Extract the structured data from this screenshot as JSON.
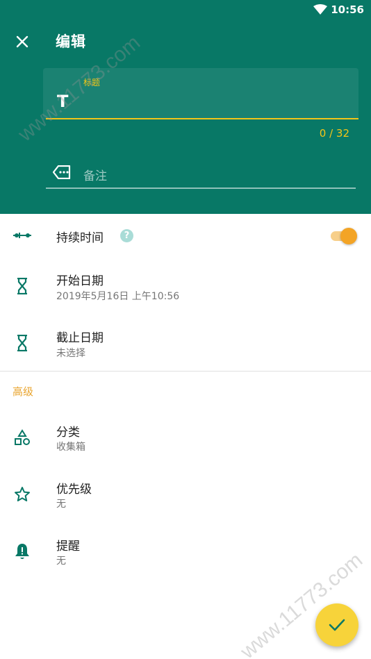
{
  "status_bar": {
    "time": "10:56"
  },
  "header": {
    "title": "编辑",
    "title_field": {
      "label": "标题",
      "value": "T",
      "counter": "0 / 32"
    },
    "note_field": {
      "placeholder": "备注"
    }
  },
  "rows": {
    "duration": {
      "title": "持续时间",
      "help": "?",
      "toggle_on": true
    },
    "start_date": {
      "title": "开始日期",
      "subtitle": "2019年5月16日 上午10:56"
    },
    "due_date": {
      "title": "截止日期",
      "subtitle": "未选择"
    }
  },
  "advanced": {
    "label": "高级",
    "category": {
      "title": "分类",
      "subtitle": "收集箱"
    },
    "priority": {
      "title": "优先级",
      "subtitle": "无"
    },
    "reminder": {
      "title": "提醒",
      "subtitle": "无"
    }
  },
  "watermark": "www.11773.com",
  "colors": {
    "primary": "#087866",
    "accent": "#f5c518",
    "toggle": "#f3a426",
    "fab": "#f7d33a"
  }
}
